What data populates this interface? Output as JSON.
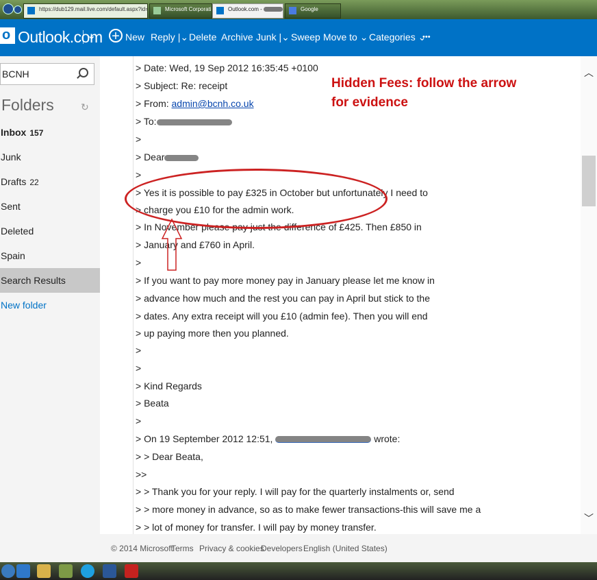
{
  "browser": {
    "tabs": [
      {
        "label": "https://dub129.mail.live.com/default.aspx?id=64855&fid=flsearch&"
      },
      {
        "label": "Microsoft Corporation [..."
      },
      {
        "label": "Outlook.com -",
        "close": "×"
      },
      {
        "label": "Google"
      }
    ]
  },
  "header": {
    "app_title": "Outlook.com",
    "toolbar": {
      "new": "New",
      "reply": "Reply",
      "delete": "Delete",
      "archive": "Archive",
      "junk": "Junk",
      "sweep": "Sweep",
      "move_to": "Move to",
      "categories": "Categories",
      "more": "•••"
    }
  },
  "search": {
    "value": "BCNH"
  },
  "folders": {
    "heading": "Folders",
    "items": [
      {
        "label": "Inbox",
        "count": "157"
      },
      {
        "label": "Junk",
        "count": ""
      },
      {
        "label": "Drafts",
        "count": "22"
      },
      {
        "label": "Sent",
        "count": ""
      },
      {
        "label": "Deleted",
        "count": ""
      },
      {
        "label": "Spain",
        "count": ""
      },
      {
        "label": "Search Results",
        "count": ""
      },
      {
        "label": "New folder",
        "count": ""
      }
    ]
  },
  "annotation": {
    "line1": "Hidden Fees: follow the arrow",
    "line2": "for evidence",
    "color": "#cc1111"
  },
  "message": {
    "date": "> Date: Wed, 19 Sep 2012 16:35:45 +0100",
    "subject": "> Subject: Re: receipt",
    "from_prefix": "> From: ",
    "from_email": "admin@bcnh.co.uk",
    "to": "> To:",
    "blank": ">",
    "dear": "> Dear",
    "l1": "> Yes it is possible to pay £325 in October but unfortunately I need to",
    "l2": "> charge you £10 for the admin work.",
    "l3": "> In November please pay just the difference of £425. Then £850 in",
    "l4": "> January and £760 in April.",
    "l5": "> If you want to pay more money pay in January please let me know in",
    "l6": "> advance how much and the rest you can pay in April but stick to the",
    "l7": "> dates. Any extra receipt will you £10 (admin fee). Then you will end",
    "l8": "> up paying more then you planned.",
    "kind": "> Kind Regards",
    "beata": "> Beata",
    "on_prefix": "> On 19 September 2012 12:51,",
    "on_suffix": "wrote:",
    "dear_beata": "> > Dear Beata,",
    "dbl": ">>",
    "t1": "> > Thank you for your reply. I will pay for the quarterly instalments or, send",
    "t2": "> > more money in advance, so as to make fewer transactions-this will save me a",
    "t3": "> > lot of money for transfer. I will pay by money transfer."
  },
  "footer": {
    "copyright": "© 2014 Microsoft",
    "terms": "Terms",
    "privacy": "Privacy & cookies",
    "developers": "Developers",
    "language": "English (United States)"
  }
}
